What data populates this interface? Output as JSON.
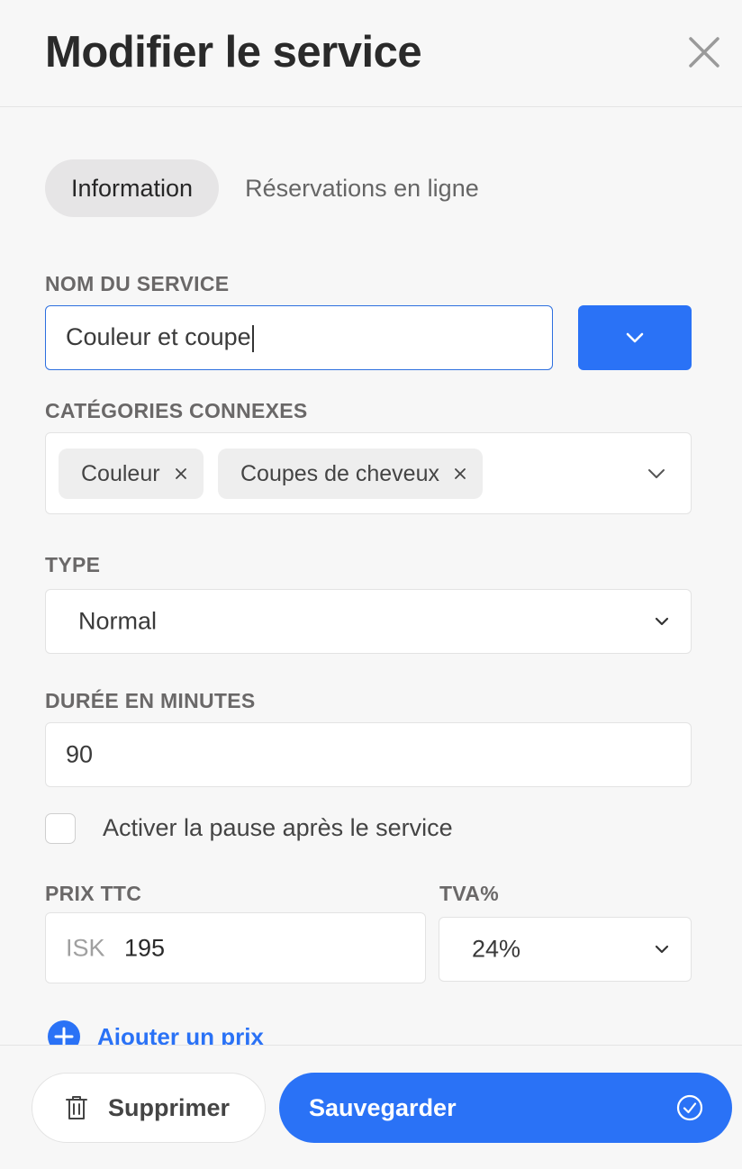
{
  "header": {
    "title": "Modifier le service",
    "close_icon": "close-icon"
  },
  "tabs": [
    {
      "label": "Information",
      "active": true
    },
    {
      "label": "Réservations en ligne",
      "active": false
    }
  ],
  "service_name": {
    "label": "NOM DU SERVICE",
    "value": "Couleur et coupe",
    "dropdown_icon": "chevron-down-icon"
  },
  "categories": {
    "label": "CATÉGORIES CONNEXES",
    "chips": [
      {
        "label": "Couleur"
      },
      {
        "label": "Coupes de cheveux"
      }
    ]
  },
  "type": {
    "label": "TYPE",
    "value": "Normal"
  },
  "duration": {
    "label": "DURÉE EN MINUTES",
    "value": "90"
  },
  "pause": {
    "label": "Activer la pause après le service",
    "checked": false
  },
  "price": {
    "label": "PRIX TTC",
    "currency": "ISK",
    "value": "195"
  },
  "vat": {
    "label": "TVA%",
    "value": "24%"
  },
  "add_price": {
    "label": "Ajouter un prix"
  },
  "footer": {
    "delete_label": "Supprimer",
    "save_label": "Sauvegarder"
  },
  "colors": {
    "accent": "#2a72f6",
    "background": "#f7f7f7"
  }
}
